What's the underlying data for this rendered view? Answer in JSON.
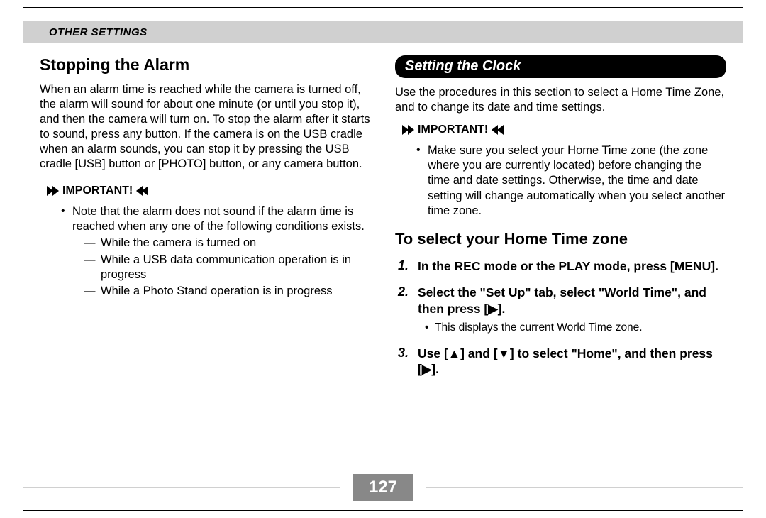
{
  "header": {
    "section": "OTHER SETTINGS"
  },
  "left": {
    "heading": "Stopping the Alarm",
    "paragraph": "When an alarm time is reached while the camera is turned off, the alarm will sound for about one minute (or until you stop it), and then the camera will turn on. To stop the alarm after it starts to sound, press any button. If the camera is on the USB cradle when an alarm sounds, you can stop it by pressing the USB cradle [USB] button or [PHOTO] button, or any camera button.",
    "important_label": "IMPORTANT!",
    "bullet1": "Note that the alarm does not sound if the alarm time is reached when any one of the following conditions exists.",
    "dash1": "While the camera is turned on",
    "dash2": "While a USB data communication operation is in progress",
    "dash3": "While a Photo Stand operation is in progress"
  },
  "right": {
    "pill": "Setting the Clock",
    "intro": "Use the procedures in this section to select a Home Time Zone, and to change its date and time settings.",
    "important_label": "IMPORTANT!",
    "impbullet": "Make sure you select your Home Time zone (the zone where you are currently located) before changing the time and date settings. Otherwise, the time and date setting will change automatically when you select another time zone.",
    "heading2": "To select your Home Time zone",
    "step1": "In the REC mode or the PLAY mode, press [MENU].",
    "step2": "Select the \"Set Up\" tab, select \"World Time\", and then press [▶].",
    "step2note": "This displays the current World Time zone.",
    "step3": "Use [▲] and [▼] to select \"Home\", and then press [▶]."
  },
  "page_number": "127"
}
